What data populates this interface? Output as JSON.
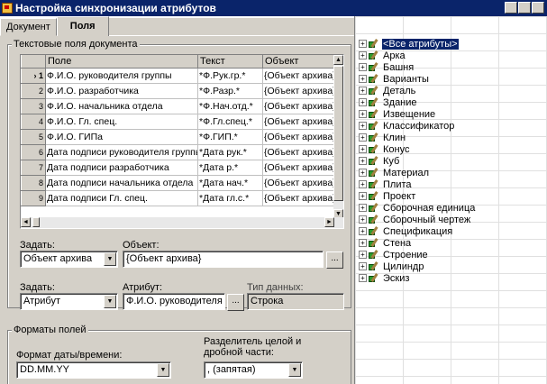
{
  "window": {
    "title": "Настройка синхронизации атрибутов"
  },
  "tabs": [
    {
      "label": "Документ",
      "active": false
    },
    {
      "label": "Поля",
      "active": true
    }
  ],
  "text_fields_group": {
    "legend": "Текстовые поля документа",
    "columns": [
      "Поле",
      "Текст",
      "Объект"
    ],
    "rows": [
      {
        "num": "1",
        "field": "Ф.И.О. руководителя группы",
        "text": "*Ф.Рук.гр.*",
        "object": "{Объект архива}",
        "current": true
      },
      {
        "num": "2",
        "field": "Ф.И.О. разработчика",
        "text": "*Ф.Разр.*",
        "object": "{Объект архива}"
      },
      {
        "num": "3",
        "field": "Ф.И.О. начальника отдела",
        "text": "*Ф.Нач.отд.*",
        "object": "{Объект архива}"
      },
      {
        "num": "4",
        "field": "Ф.И.О. Гл. спец.",
        "text": "*Ф.Гл.спец.*",
        "object": "{Объект архива}"
      },
      {
        "num": "5",
        "field": "Ф.И.О. ГИПа",
        "text": "*Ф.ГИП.*",
        "object": "{Объект архива}"
      },
      {
        "num": "6",
        "field": "Дата подписи руководителя группы",
        "text": "*Дата рук.*",
        "object": "{Объект архива}"
      },
      {
        "num": "7",
        "field": "Дата подписи разработчика",
        "text": "*Дата р.*",
        "object": "{Объект архива}"
      },
      {
        "num": "8",
        "field": "Дата подписи начальника отдела",
        "text": "*Дата нач.*",
        "object": "{Объект архива}"
      },
      {
        "num": "9",
        "field": "Дата подписи Гл. спец.",
        "text": "*Дата гл.с.*",
        "object": "{Объект архива}"
      }
    ],
    "set1_label": "Задать:",
    "set1_value": "Объект архива",
    "object_label": "Объект:",
    "object_value": "{Объект архива}",
    "set2_label": "Задать:",
    "set2_value": "Атрибут",
    "attribute_label": "Атрибут:",
    "attribute_value": "Ф.И.О. руководителя гру",
    "datatype_label": "Тип данных:",
    "datatype_value": "Строка",
    "dots": "..."
  },
  "formats_group": {
    "legend": "Форматы полей",
    "date_format_label": "Формат даты/времени:",
    "date_format_value": "DD.MM.YY",
    "separator_label_1": "Разделитель целой и",
    "separator_label_2": "дробной части:",
    "separator_value": ", (запятая)"
  },
  "tree": {
    "items": [
      {
        "label": "<Все атрибуты>",
        "selected": true
      },
      {
        "label": "Арка"
      },
      {
        "label": "Башня"
      },
      {
        "label": "Варианты"
      },
      {
        "label": "Деталь"
      },
      {
        "label": "Здание"
      },
      {
        "label": "Извещение"
      },
      {
        "label": "Классификатор"
      },
      {
        "label": "Клин"
      },
      {
        "label": "Конус"
      },
      {
        "label": "Куб"
      },
      {
        "label": "Материал"
      },
      {
        "label": "Плита"
      },
      {
        "label": "Проект"
      },
      {
        "label": "Сборочная единица"
      },
      {
        "label": "Сборочный чертеж"
      },
      {
        "label": "Спецификация"
      },
      {
        "label": "Стена"
      },
      {
        "label": "Строение"
      },
      {
        "label": "Цилиндр"
      },
      {
        "label": "Эскиз"
      }
    ]
  },
  "icons": {
    "expander": "+",
    "scroll_up": "▲",
    "scroll_down": "▼",
    "scroll_left": "◄",
    "scroll_right": "►",
    "combo": "▼"
  }
}
